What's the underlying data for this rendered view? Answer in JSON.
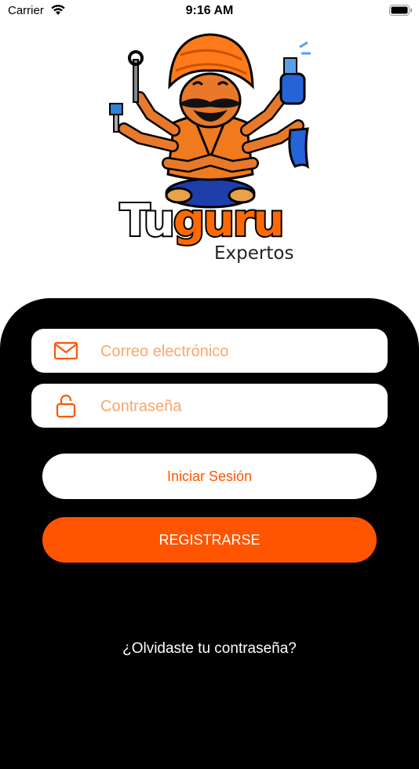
{
  "status_bar": {
    "carrier": "Carrier",
    "time": "9:16 AM"
  },
  "logo": {
    "word_part1": "Tu",
    "word_part2": "guru",
    "subtitle": "Expertos"
  },
  "form": {
    "email_placeholder": "Correo electrónico",
    "password_placeholder": "Contraseña",
    "email_icon": "mail-icon",
    "password_icon": "unlock-icon"
  },
  "buttons": {
    "login_label": "Iniciar Sesión",
    "register_label": "REGISTRARSE"
  },
  "links": {
    "forgot_password": "¿Olvidaste tu contraseña?"
  },
  "colors": {
    "accent": "#ff5500",
    "panel": "#000000",
    "placeholder": "#f9a66c"
  }
}
